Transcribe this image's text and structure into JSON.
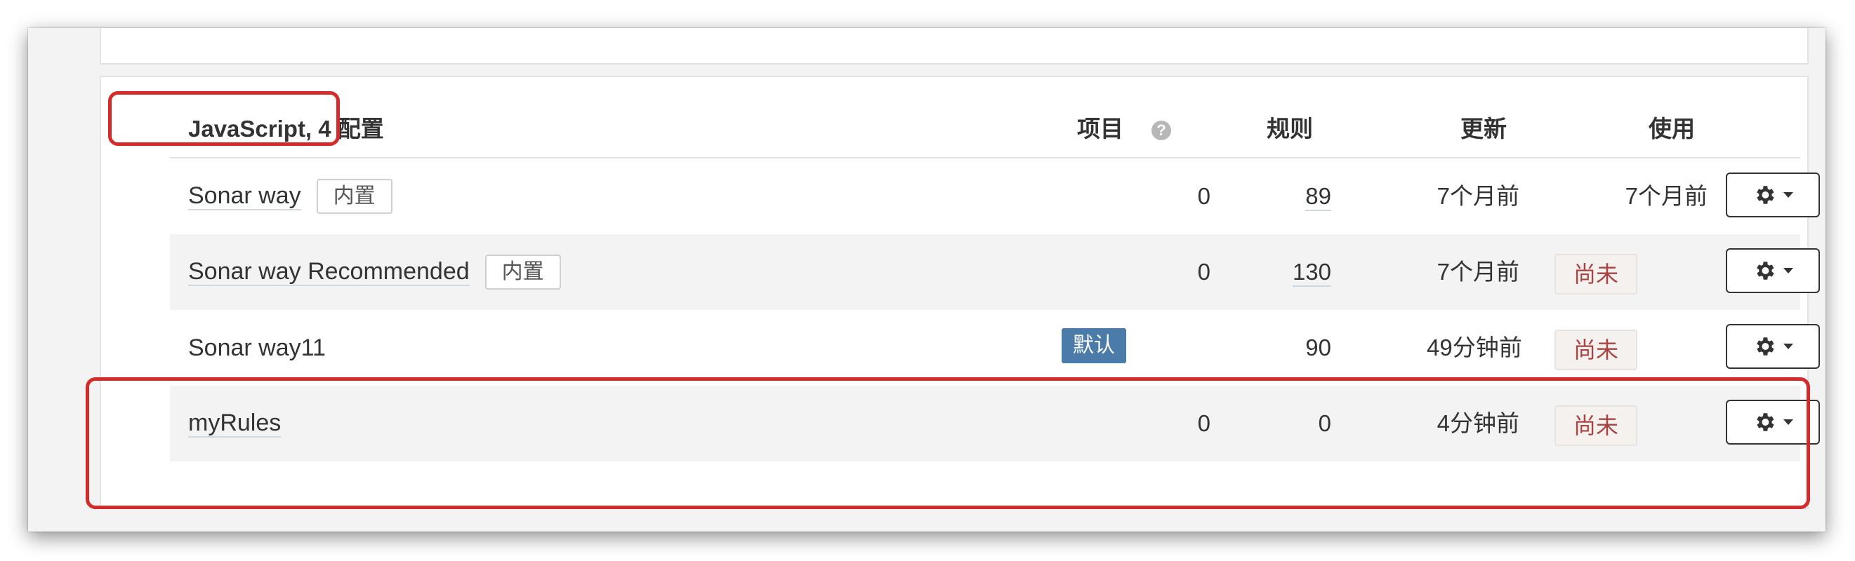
{
  "header": {
    "title": "JavaScript, 4 配置",
    "projects": "项目",
    "projects_help": "?",
    "rules": "规则",
    "updated": "更新",
    "used": "使用"
  },
  "rows": [
    {
      "name": "Sonar way",
      "badge": "内置",
      "projects": "0",
      "rules": "89",
      "updated": "7个月前",
      "used": "7个月前"
    },
    {
      "name": "Sonar way Recommended",
      "badge": "内置",
      "projects": "0",
      "rules": "130",
      "updated": "7个月前",
      "used": "尚未"
    },
    {
      "name": "Sonar way11",
      "default_badge": "默认",
      "rules": "90",
      "updated": "49分钟前",
      "used": "尚未"
    },
    {
      "name": "myRules",
      "projects": "0",
      "rules": "0",
      "updated": "4分钟前",
      "used": "尚未"
    }
  ],
  "colors": {
    "annotation": "#d42a2a",
    "default_badge": "#4b7ba9",
    "unused_text": "#a94442"
  },
  "icons": {
    "actions": "gear-icon",
    "menu": "caret-down-icon",
    "help": "help-icon"
  }
}
